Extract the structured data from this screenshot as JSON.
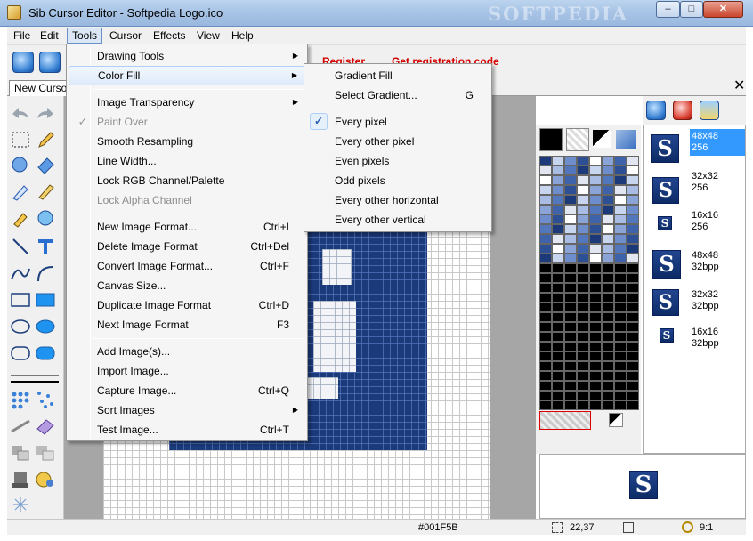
{
  "window": {
    "title": "Sib Cursor Editor - Softpedia Logo.ico",
    "watermark": "SOFTPEDIA",
    "controls": {
      "minimize": "–",
      "maximize": "□",
      "close": "✕"
    }
  },
  "menubar": [
    "File",
    "Edit",
    "Tools",
    "Cursor",
    "Effects",
    "View",
    "Help"
  ],
  "toolbar": {
    "register": "Register...",
    "registration_code": "Get registration code"
  },
  "tabs": {
    "new_cursor": "New Cursor",
    "close": "✕"
  },
  "tools_menu": {
    "items": [
      {
        "label": "Drawing Tools",
        "submenu": true
      },
      {
        "label": "Color Fill",
        "submenu": true
      },
      {
        "label": "Image Transparency",
        "submenu": true
      },
      {
        "label": "Paint Over",
        "disabled": true,
        "checked": true
      },
      {
        "label": "Smooth Resampling"
      },
      {
        "label": "Line Width..."
      },
      {
        "label": "Lock RGB Channel/Palette"
      },
      {
        "label": "Lock Alpha Channel",
        "disabled": true
      },
      {
        "label": "New Image Format...",
        "shortcut": "Ctrl+I"
      },
      {
        "label": "Delete Image Format",
        "shortcut": "Ctrl+Del"
      },
      {
        "label": "Convert Image Format...",
        "shortcut": "Ctrl+F"
      },
      {
        "label": "Canvas Size..."
      },
      {
        "label": "Duplicate Image Format",
        "shortcut": "Ctrl+D"
      },
      {
        "label": "Next Image Format",
        "shortcut": "F3"
      },
      {
        "label": "Add Image(s)..."
      },
      {
        "label": "Import Image..."
      },
      {
        "label": "Capture Image...",
        "shortcut": "Ctrl+Q"
      },
      {
        "label": "Sort Images",
        "submenu": true
      },
      {
        "label": "Test Image...",
        "shortcut": "Ctrl+T"
      }
    ]
  },
  "color_fill_menu": {
    "items": [
      {
        "label": "Gradient Fill"
      },
      {
        "label": "Select Gradient...",
        "shortcut": "G"
      },
      {
        "label": "Every pixel",
        "checked": true
      },
      {
        "label": "Every other pixel"
      },
      {
        "label": "Even pixels"
      },
      {
        "label": "Odd pixels"
      },
      {
        "label": "Every other horizontal"
      },
      {
        "label": "Every other vertical"
      }
    ],
    "check_glyph": "✓"
  },
  "image_formats": [
    {
      "size": "48x48",
      "depth": "256",
      "selected": true
    },
    {
      "size": "32x32",
      "depth": "256"
    },
    {
      "size": "16x16",
      "depth": "256"
    },
    {
      "size": "48x48",
      "depth": "32bpp"
    },
    {
      "size": "32x32",
      "depth": "32bpp"
    },
    {
      "size": "16x16",
      "depth": "32bpp"
    }
  ],
  "thumb_letter": "S",
  "status": {
    "color": "#001F5B",
    "coords": "22,37",
    "zoom": "9:1"
  },
  "colors": {
    "accent": "#3399ff",
    "register_red": "#d40000",
    "image_blue": "#1b3a7a"
  }
}
